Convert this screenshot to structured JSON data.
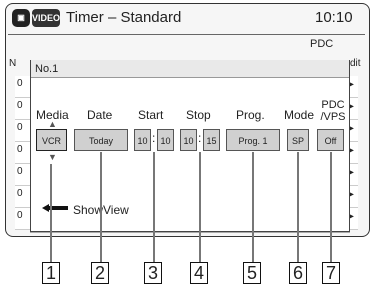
{
  "header": {
    "badge": "VIDEO",
    "title": "Timer – Standard",
    "time": "10:10"
  },
  "background": {
    "pdc_label": "PDC",
    "edit_label": "dit",
    "row_numbers": [
      "0",
      "0",
      "0",
      "0",
      "0",
      "0",
      "0"
    ],
    "left_fragment": "N"
  },
  "dialog": {
    "title": "No.1",
    "columns": {
      "media": "Media",
      "date": "Date",
      "start": "Start",
      "stop": "Stop",
      "prog": "Prog.",
      "mode": "Mode",
      "pdc_vps": "PDC /VPS"
    },
    "values": {
      "media": "VCR",
      "date": "Today",
      "start_h": "10",
      "start_m": "10",
      "stop_h": "10",
      "stop_m": "15",
      "prog": "Prog. 1",
      "mode": "SP",
      "pdc_vps": "Off"
    },
    "showview_label": "ShowView"
  },
  "callouts": [
    "1",
    "2",
    "3",
    "4",
    "5",
    "6",
    "7"
  ]
}
